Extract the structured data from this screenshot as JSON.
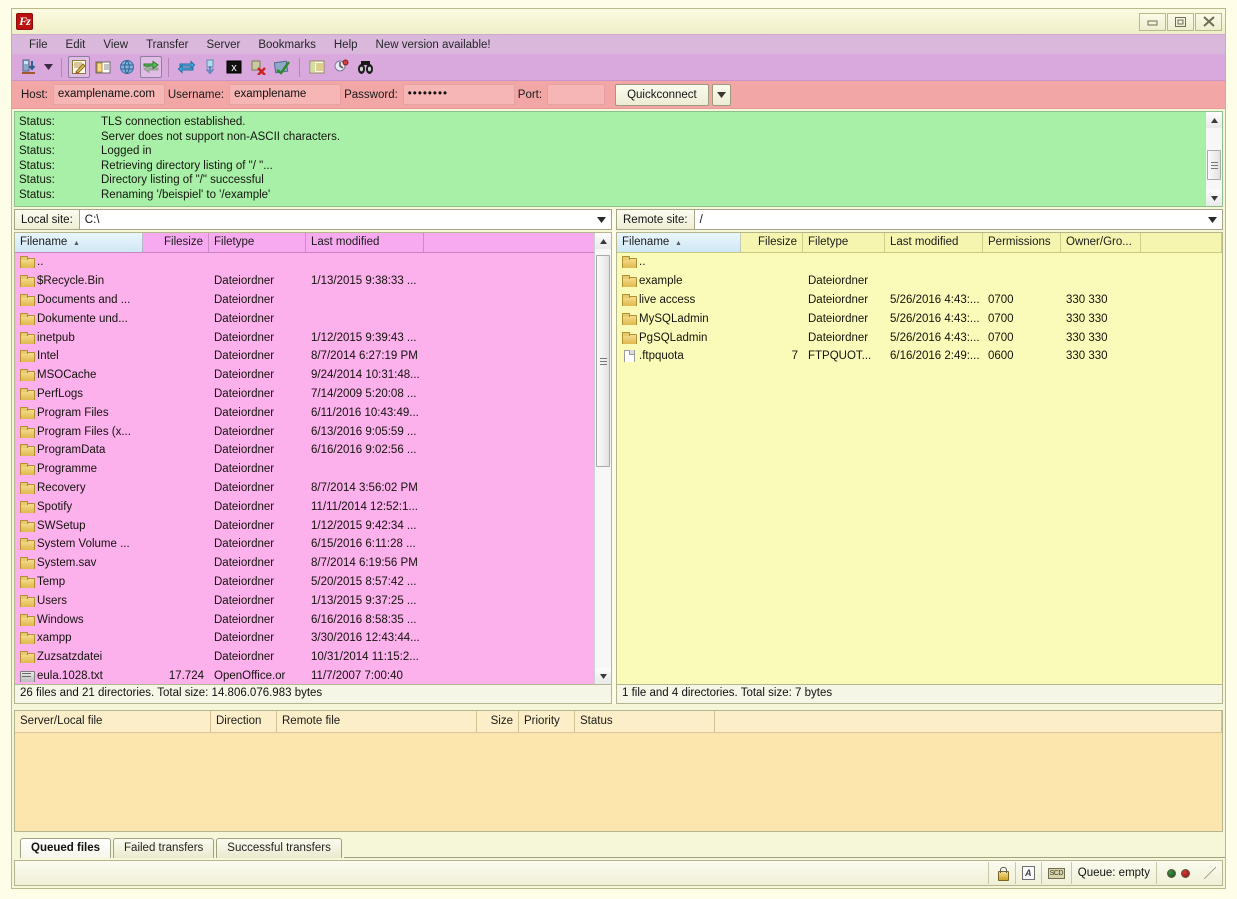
{
  "window": {
    "title": "",
    "logo_icon": "filezilla-logo-icon",
    "minimize_label": "minimize-icon",
    "maximize_label": "maximize-icon",
    "close_label": "close-icon"
  },
  "menubar": {
    "items": [
      {
        "label": "File"
      },
      {
        "label": "Edit"
      },
      {
        "label": "View"
      },
      {
        "label": "Transfer"
      },
      {
        "label": "Server"
      },
      {
        "label": "Bookmarks"
      },
      {
        "label": "Help"
      },
      {
        "label": "New version available!"
      }
    ]
  },
  "toolbar": {
    "items": [
      {
        "name": "site-manager-icon"
      },
      {
        "name": "site-manager-dropdown-icon"
      },
      {
        "name": "toggle-message-log-icon"
      },
      {
        "name": "toggle-local-tree-icon"
      },
      {
        "name": "toggle-remote-tree-icon"
      },
      {
        "name": "toggle-transfer-queue-icon"
      },
      {
        "name": "refresh-icon"
      },
      {
        "name": "process-queue-icon"
      },
      {
        "name": "cancel-operation-icon"
      },
      {
        "name": "disconnect-icon"
      },
      {
        "name": "reconnect-icon"
      },
      {
        "name": "toggle-filters-icon"
      },
      {
        "name": "directory-comparison-icon"
      },
      {
        "name": "synchronized-browsing-icon"
      },
      {
        "name": "find-files-icon"
      }
    ]
  },
  "quickconnect": {
    "host_label": "Host:",
    "host_value": "examplename.com",
    "user_label": "Username:",
    "user_value": "examplename",
    "pass_label": "Password:",
    "pass_value": "••••••••",
    "port_label": "Port:",
    "port_value": "",
    "button_label": "Quickconnect",
    "dropdown_icon": "chevron-down-icon"
  },
  "log": {
    "rows": [
      {
        "k": "Status:",
        "v": "TLS connection established."
      },
      {
        "k": "Status:",
        "v": "Server does not support non-ASCII characters."
      },
      {
        "k": "Status:",
        "v": "Logged in"
      },
      {
        "k": "Status:",
        "v": "Retrieving directory listing of \"/ \"..."
      },
      {
        "k": "Status:",
        "v": "Directory listing of \"/\" successful"
      },
      {
        "k": "Status:",
        "v": "Renaming '/beispiel' to '/example'"
      }
    ]
  },
  "local": {
    "site_label": "Local site:",
    "site_value": "C:\\",
    "columns": [
      "Filename",
      "Filesize",
      "Filetype",
      "Last modified"
    ],
    "sort_column": "Filename",
    "rows": [
      {
        "name": "..",
        "icon": "folder-up-icon",
        "size": "",
        "type": "",
        "modified": ""
      },
      {
        "name": "$Recycle.Bin",
        "icon": "folder-icon",
        "size": "",
        "type": "Dateiordner",
        "modified": "1/13/2015 9:38:33 ..."
      },
      {
        "name": "Documents and ...",
        "icon": "folder-icon",
        "size": "",
        "type": "Dateiordner",
        "modified": ""
      },
      {
        "name": "Dokumente und...",
        "icon": "folder-icon",
        "size": "",
        "type": "Dateiordner",
        "modified": ""
      },
      {
        "name": "inetpub",
        "icon": "folder-icon",
        "size": "",
        "type": "Dateiordner",
        "modified": "1/12/2015 9:39:43 ..."
      },
      {
        "name": "Intel",
        "icon": "folder-icon",
        "size": "",
        "type": "Dateiordner",
        "modified": "8/7/2014 6:27:19 PM"
      },
      {
        "name": "MSOCache",
        "icon": "folder-icon",
        "size": "",
        "type": "Dateiordner",
        "modified": "9/24/2014 10:31:48..."
      },
      {
        "name": "PerfLogs",
        "icon": "folder-icon",
        "size": "",
        "type": "Dateiordner",
        "modified": "7/14/2009 5:20:08 ..."
      },
      {
        "name": "Program Files",
        "icon": "folder-icon",
        "size": "",
        "type": "Dateiordner",
        "modified": "6/11/2016 10:43:49..."
      },
      {
        "name": "Program Files (x...",
        "icon": "folder-icon",
        "size": "",
        "type": "Dateiordner",
        "modified": "6/13/2016 9:05:59 ..."
      },
      {
        "name": "ProgramData",
        "icon": "folder-icon",
        "size": "",
        "type": "Dateiordner",
        "modified": "6/16/2016 9:02:56 ..."
      },
      {
        "name": "Programme",
        "icon": "folder-icon",
        "size": "",
        "type": "Dateiordner",
        "modified": ""
      },
      {
        "name": "Recovery",
        "icon": "folder-icon",
        "size": "",
        "type": "Dateiordner",
        "modified": "8/7/2014 3:56:02 PM"
      },
      {
        "name": "Spotify",
        "icon": "folder-icon",
        "size": "",
        "type": "Dateiordner",
        "modified": "11/11/2014 12:52:1..."
      },
      {
        "name": "SWSetup",
        "icon": "folder-icon",
        "size": "",
        "type": "Dateiordner",
        "modified": "1/12/2015 9:42:34 ..."
      },
      {
        "name": "System Volume ...",
        "icon": "folder-icon",
        "size": "",
        "type": "Dateiordner",
        "modified": "6/15/2016 6:11:28 ..."
      },
      {
        "name": "System.sav",
        "icon": "folder-icon",
        "size": "",
        "type": "Dateiordner",
        "modified": "8/7/2014 6:19:56 PM"
      },
      {
        "name": "Temp",
        "icon": "folder-icon",
        "size": "",
        "type": "Dateiordner",
        "modified": "5/20/2015 8:57:42 ..."
      },
      {
        "name": "Users",
        "icon": "folder-icon",
        "size": "",
        "type": "Dateiordner",
        "modified": "1/13/2015 9:37:25 ..."
      },
      {
        "name": "Windows",
        "icon": "folder-icon",
        "size": "",
        "type": "Dateiordner",
        "modified": "6/16/2016 8:58:35 ..."
      },
      {
        "name": "xampp",
        "icon": "folder-icon",
        "size": "",
        "type": "Dateiordner",
        "modified": "3/30/2016 12:43:44..."
      },
      {
        "name": "Zuzsatzdatei",
        "icon": "folder-icon",
        "size": "",
        "type": "Dateiordner",
        "modified": "10/31/2014 11:15:2..."
      },
      {
        "name": "eula.1028.txt",
        "icon": "document-icon",
        "size": "17.724",
        "type": "OpenOffice.or",
        "modified": "11/7/2007 7:00:40"
      }
    ],
    "status": "26 files and 21 directories. Total size: 14.806.076.983 bytes"
  },
  "remote": {
    "site_label": "Remote site:",
    "site_value": "/",
    "columns": [
      "Filename",
      "Filesize",
      "Filetype",
      "Last modified",
      "Permissions",
      "Owner/Gro..."
    ],
    "sort_column": "Filename",
    "rows": [
      {
        "name": "..",
        "icon": "folder-up-icon",
        "size": "",
        "type": "",
        "modified": "",
        "perms": "",
        "owner": ""
      },
      {
        "name": "example",
        "icon": "folder-icon",
        "size": "",
        "type": "Dateiordner",
        "modified": "",
        "perms": "",
        "owner": ""
      },
      {
        "name": "live access",
        "icon": "folder-icon",
        "size": "",
        "type": "Dateiordner",
        "modified": "5/26/2016 4:43:...",
        "perms": "0700",
        "owner": "330 330"
      },
      {
        "name": "MySQLadmin",
        "icon": "folder-icon",
        "size": "",
        "type": "Dateiordner",
        "modified": "5/26/2016 4:43:...",
        "perms": "0700",
        "owner": "330 330"
      },
      {
        "name": "PgSQLadmin",
        "icon": "folder-icon",
        "size": "",
        "type": "Dateiordner",
        "modified": "5/26/2016 4:43:...",
        "perms": "0700",
        "owner": "330 330"
      },
      {
        "name": ".ftpquota",
        "icon": "file-icon",
        "size": "7",
        "type": "FTPQUOT...",
        "modified": "6/16/2016 2:49:...",
        "perms": "0600",
        "owner": "330 330"
      }
    ],
    "status": "1 file and 4 directories. Total size: 7 bytes"
  },
  "queue": {
    "columns": [
      "Server/Local file",
      "Direction",
      "Remote file",
      "Size",
      "Priority",
      "Status"
    ],
    "rows": [],
    "tabs": [
      {
        "label": "Queued files",
        "active": true
      },
      {
        "label": "Failed transfers",
        "active": false
      },
      {
        "label": "Successful transfers",
        "active": false
      }
    ]
  },
  "statusbar": {
    "lock_icon": "lock-icon",
    "cert_icon": "certificate-icon",
    "encoding_icon": "scd-icon",
    "queue_text": "Queue: empty",
    "led_green": "#2f6b2f",
    "led_red": "#c02a2a",
    "resize_icon": "resize-grip-icon"
  },
  "colors": {
    "menubar": "#d9b8db",
    "toolbar": "#d9a9dd",
    "quickconnect": "#f2a6a6",
    "log": "#a8f0a8",
    "local_list": "#fcb0ec",
    "local_header": "#f8aaf0",
    "remote_list": "#fbfbb9",
    "remote_header": "#f5f5b0",
    "queue": "#fde5ae",
    "window_bg": "#f6f6d8"
  }
}
